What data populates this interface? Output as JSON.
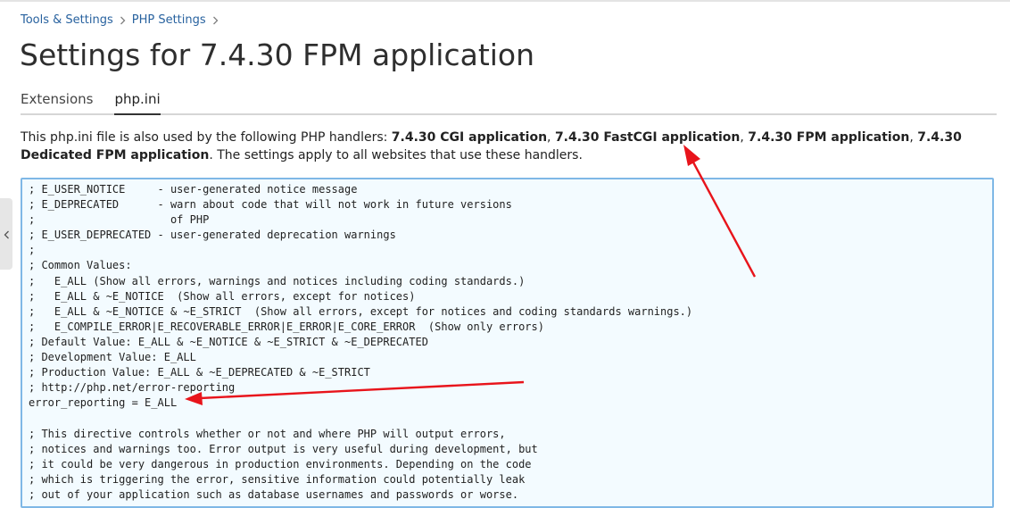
{
  "breadcrumb": {
    "items": [
      {
        "label": "Tools & Settings"
      },
      {
        "label": "PHP Settings"
      }
    ]
  },
  "page": {
    "title": "Settings for 7.4.30 FPM application"
  },
  "tabs": [
    {
      "label": "Extensions",
      "active": false
    },
    {
      "label": "php.ini",
      "active": true
    }
  ],
  "info": {
    "prefix": "This php.ini file is also used by the following PHP handlers: ",
    "handlers": [
      "7.4.30 CGI application",
      "7.4.30 FastCGI application",
      "7.4.30 FPM application",
      "7.4.30 Dedicated FPM application"
    ],
    "separator": ", ",
    "suffix": ". The settings apply to all websites that use these handlers."
  },
  "editor": {
    "lines": [
      "; E_USER_NOTICE     - user-generated notice message",
      "; E_DEPRECATED      - warn about code that will not work in future versions",
      ";                     of PHP",
      "; E_USER_DEPRECATED - user-generated deprecation warnings",
      ";",
      "; Common Values:",
      ";   E_ALL (Show all errors, warnings and notices including coding standards.)",
      ";   E_ALL & ~E_NOTICE  (Show all errors, except for notices)",
      ";   E_ALL & ~E_NOTICE & ~E_STRICT  (Show all errors, except for notices and coding standards warnings.)",
      ";   E_COMPILE_ERROR|E_RECOVERABLE_ERROR|E_ERROR|E_CORE_ERROR  (Show only errors)",
      "; Default Value: E_ALL & ~E_NOTICE & ~E_STRICT & ~E_DEPRECATED",
      "; Development Value: E_ALL",
      "; Production Value: E_ALL & ~E_DEPRECATED & ~E_STRICT",
      "; http://php.net/error-reporting",
      "error_reporting = E_ALL",
      "",
      "; This directive controls whether or not and where PHP will output errors,",
      "; notices and warnings too. Error output is very useful during development, but",
      "; it could be very dangerous in production environments. Depending on the code",
      "; which is triggering the error, sensitive information could potentially leak",
      "; out of your application such as database usernames and passwords or worse."
    ]
  },
  "icons": {
    "breadcrumb_separator": "chevron-right-icon",
    "side_handle": "chevron-left-icon"
  },
  "colors": {
    "link": "#28629f",
    "editor_border": "#7fb8e6",
    "editor_background": "#f3fbff",
    "annotation_arrow": "#e8141b"
  }
}
